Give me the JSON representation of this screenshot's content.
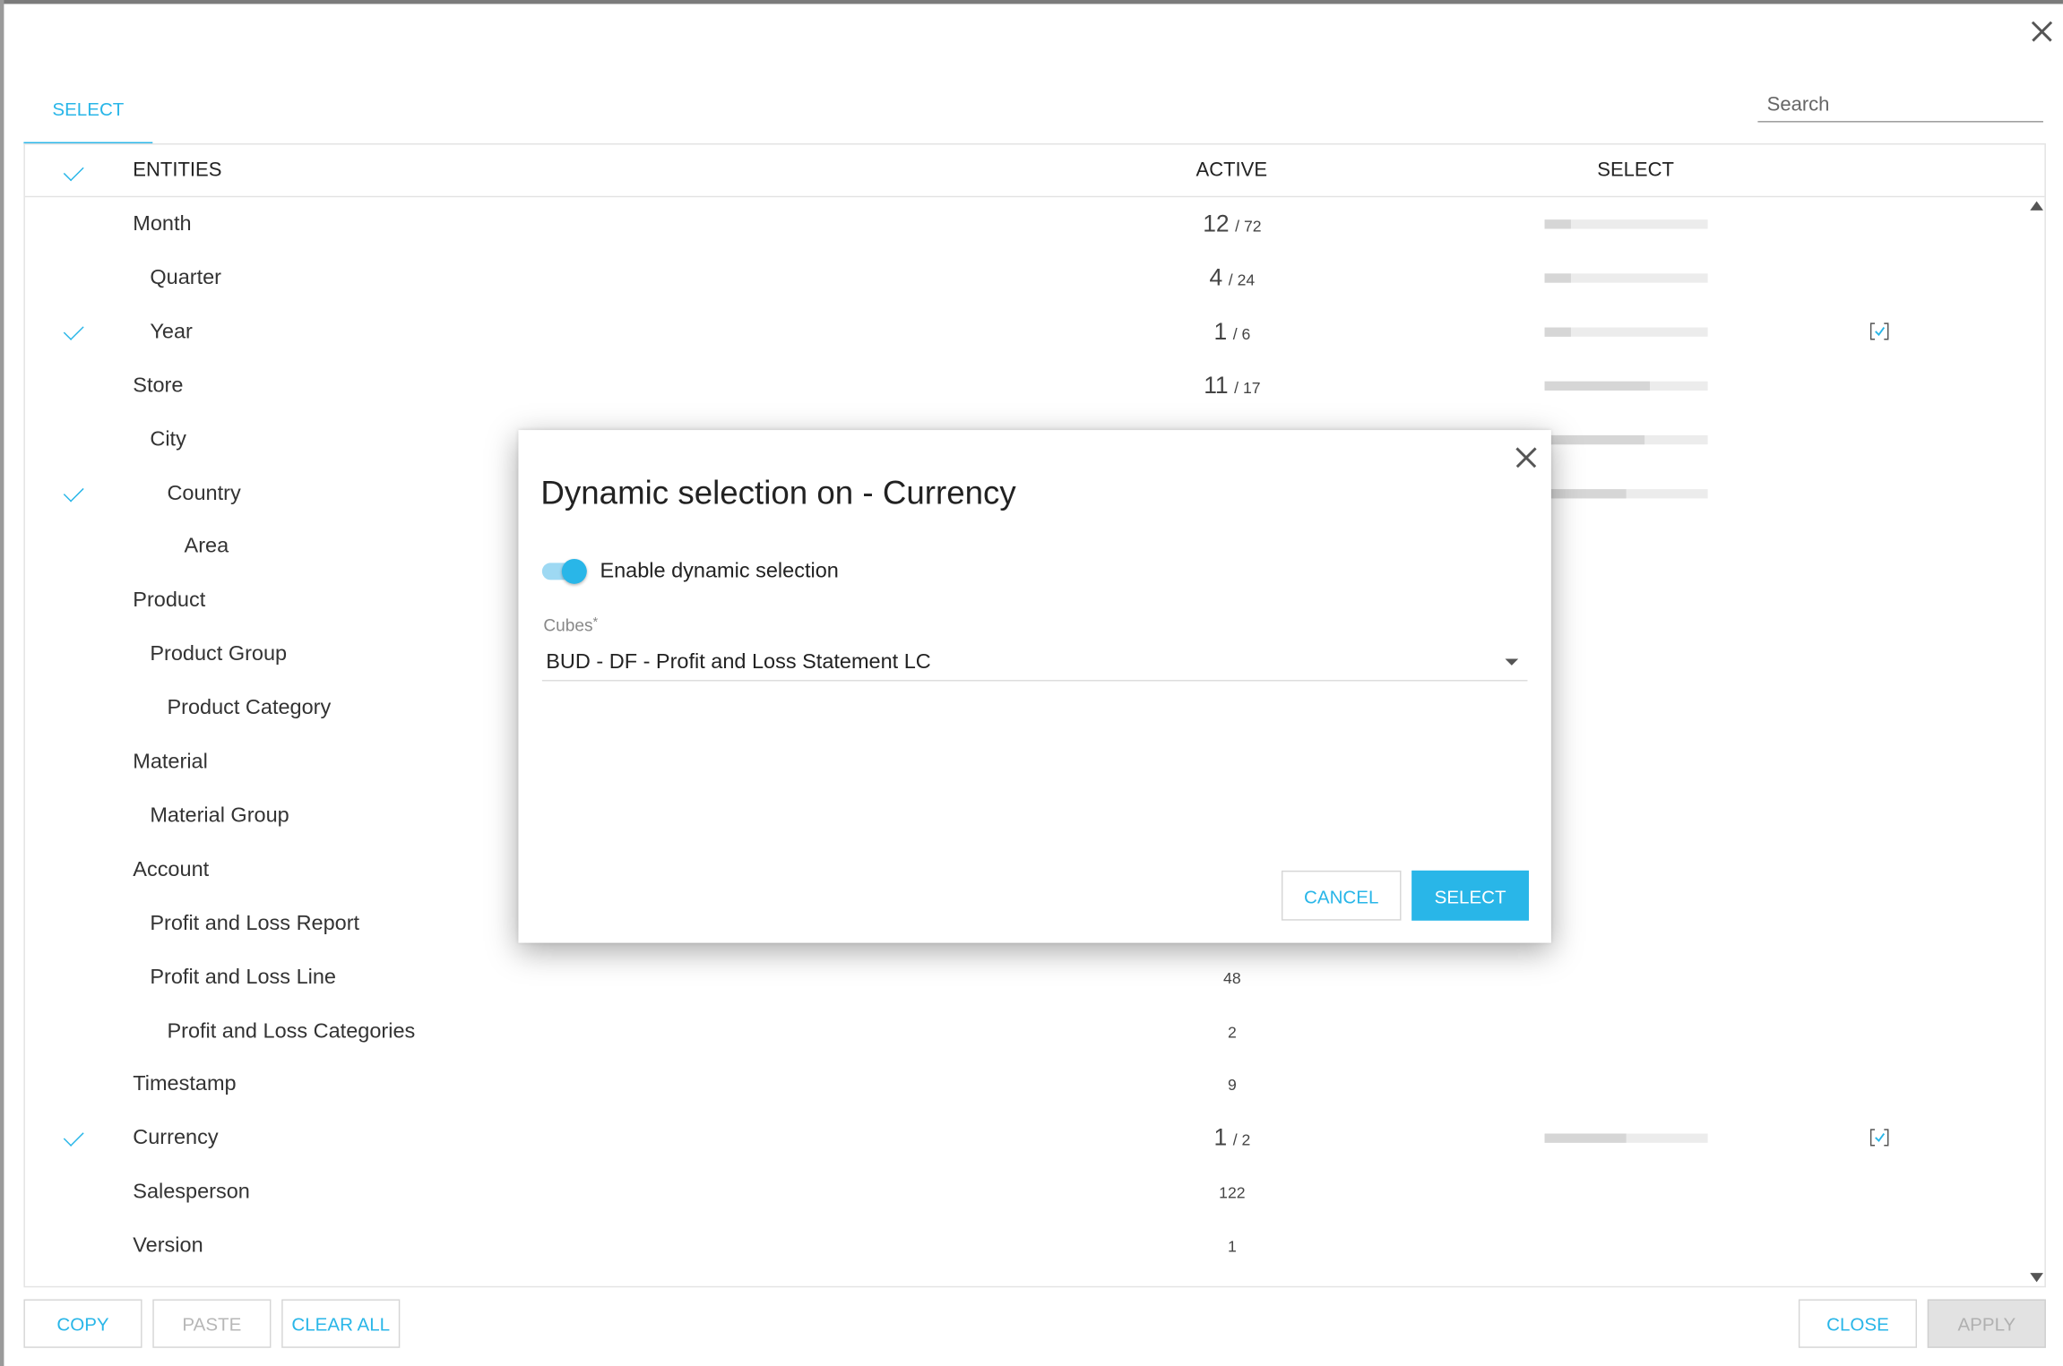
{
  "tab": {
    "label": "SELECT"
  },
  "search": {
    "placeholder": "Search"
  },
  "table": {
    "headers": {
      "entities": "ENTITIES",
      "active": "ACTIVE",
      "select": "SELECT"
    },
    "rows": [
      {
        "name": "Month",
        "checked": false,
        "big": "12",
        "small": "/ 72",
        "fill": 0.161,
        "dynamic": false
      },
      {
        "name": "Quarter",
        "checked": false,
        "big": "4",
        "small": "/ 24",
        "fill": 0.161,
        "dynamic": false
      },
      {
        "name": "Year",
        "checked": true,
        "big": "1",
        "small": "/ 6",
        "fill": 0.161,
        "dynamic": true
      },
      {
        "name": "Store",
        "checked": false,
        "big": "11",
        "small": "/ 17",
        "fill": 0.645,
        "dynamic": false
      },
      {
        "name": "City",
        "checked": false,
        "big": "",
        "small": "",
        "fill": 0.61,
        "dynamic": false
      },
      {
        "name": "Country",
        "checked": true,
        "big": "",
        "small": "",
        "fill": 0.5,
        "dynamic": false
      },
      {
        "name": "Area",
        "checked": false,
        "big": "",
        "small": "",
        "fill": null,
        "dynamic": false
      },
      {
        "name": "Product",
        "checked": false,
        "big": "",
        "small": "",
        "fill": null,
        "dynamic": false
      },
      {
        "name": "Product Group",
        "checked": false,
        "big": "",
        "small": "",
        "fill": null,
        "dynamic": false
      },
      {
        "name": "Product Category",
        "checked": false,
        "big": "",
        "small": "",
        "fill": null,
        "dynamic": false
      },
      {
        "name": "Material",
        "checked": false,
        "big": "",
        "small": "",
        "fill": null,
        "dynamic": false
      },
      {
        "name": "Material Group",
        "checked": false,
        "big": "",
        "small": "",
        "fill": null,
        "dynamic": false
      },
      {
        "name": "Account",
        "checked": false,
        "big": "",
        "small": "",
        "fill": null,
        "dynamic": false
      },
      {
        "name": "Profit and Loss Report",
        "checked": false,
        "big": "",
        "small": "",
        "fill": null,
        "dynamic": false
      },
      {
        "name": "Profit and Loss Line",
        "checked": false,
        "big": "",
        "small": "48",
        "fill": null,
        "dynamic": false
      },
      {
        "name": "Profit and Loss Categories",
        "checked": false,
        "big": "",
        "small": "2",
        "fill": null,
        "dynamic": false
      },
      {
        "name": "Timestamp",
        "checked": false,
        "big": "",
        "small": "9",
        "fill": null,
        "dynamic": false
      },
      {
        "name": "Currency",
        "checked": true,
        "big": "1",
        "small": "/ 2",
        "fill": 0.5,
        "dynamic": true
      },
      {
        "name": "Salesperson",
        "checked": false,
        "big": "",
        "small": "122",
        "fill": null,
        "dynamic": false
      },
      {
        "name": "Version",
        "checked": false,
        "big": "",
        "small": "1",
        "fill": null,
        "dynamic": false
      }
    ]
  },
  "footer": {
    "copy": "COPY",
    "paste": "PASTE",
    "clear_all": "CLEAR ALL",
    "close": "CLOSE",
    "apply": "APPLY"
  },
  "dialog": {
    "title": "Dynamic selection on - Currency",
    "toggle_label": "Enable dynamic selection",
    "toggle_on": true,
    "field_label": "Cubes",
    "field_required_mark": "*",
    "field_value": "BUD - DF - Profit and Loss Statement LC",
    "cancel": "CANCEL",
    "select": "SELECT"
  },
  "colors": {
    "accent": "#29b6e8"
  }
}
